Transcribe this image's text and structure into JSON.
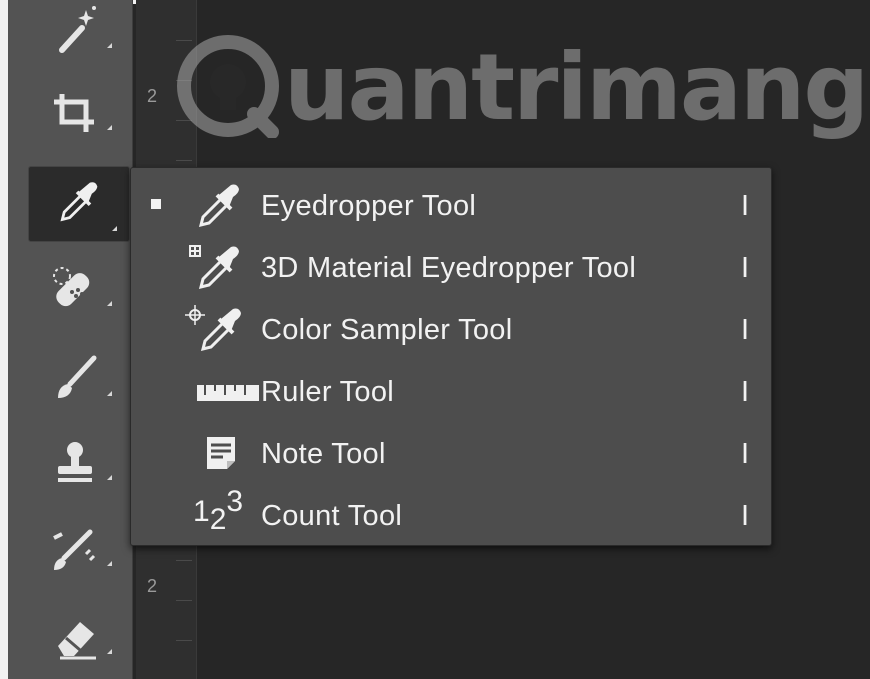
{
  "toolbar": {
    "tools": [
      {
        "name": "magic-wand-icon"
      },
      {
        "name": "crop-icon"
      },
      {
        "name": "eyedropper-icon",
        "active": true
      },
      {
        "name": "spot-healing-brush-icon"
      },
      {
        "name": "brush-icon"
      },
      {
        "name": "clone-stamp-icon"
      },
      {
        "name": "history-brush-icon"
      },
      {
        "name": "eraser-icon"
      }
    ]
  },
  "ruler": {
    "top_number": "2",
    "bottom_number": "2"
  },
  "watermark": {
    "text": "uantrimang"
  },
  "menu": {
    "items": [
      {
        "label": "Eyedropper Tool",
        "shortcut": "I",
        "icon": "eyedropper-icon",
        "selected": true
      },
      {
        "label": "3D Material Eyedropper Tool",
        "shortcut": "I",
        "icon": "3d-material-eyedropper-icon"
      },
      {
        "label": "Color Sampler Tool",
        "shortcut": "I",
        "icon": "color-sampler-icon"
      },
      {
        "label": "Ruler Tool",
        "shortcut": "I",
        "icon": "ruler-icon"
      },
      {
        "label": "Note Tool",
        "shortcut": "I",
        "icon": "note-icon"
      },
      {
        "label": "Count Tool",
        "shortcut": "I",
        "icon": "count-icon"
      }
    ],
    "count_icon_digits": {
      "one": "1",
      "two": "2",
      "three": "3"
    }
  },
  "colors": {
    "panel": "#535353",
    "menu": "#4d4d4d",
    "text": "#f2f2f2",
    "canvas": "#262626"
  }
}
